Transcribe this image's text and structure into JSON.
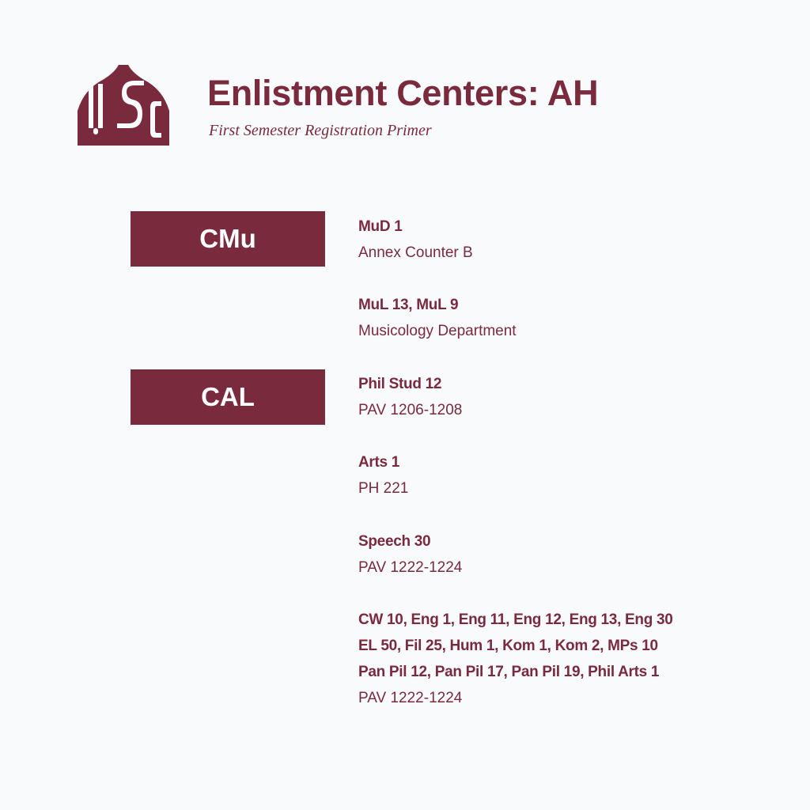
{
  "header": {
    "logo_text": "USC",
    "title": "Enlistment Centers: AH",
    "subtitle": "First Semester Registration Primer"
  },
  "colors": {
    "accent": "#7a2a3d",
    "background": "#f9fafc"
  },
  "groups": [
    {
      "label": "CMu",
      "entries": [
        {
          "courses": [
            "MuD 1"
          ],
          "location": "Annex Counter B"
        },
        {
          "courses": [
            "MuL 13, MuL 9"
          ],
          "location": "Musicology Department"
        }
      ]
    },
    {
      "label": "CAL",
      "entries": [
        {
          "courses": [
            "Phil Stud 12"
          ],
          "location": "PAV 1206-1208"
        },
        {
          "courses": [
            "Arts 1"
          ],
          "location": "PH 221"
        },
        {
          "courses": [
            "Speech 30"
          ],
          "location": "PAV 1222-1224"
        },
        {
          "courses": [
            "CW 10, Eng 1, Eng 11, Eng 12, Eng 13, Eng 30",
            "EL 50, Fil 25, Hum 1, Kom 1, Kom 2, MPs 10",
            "Pan Pil 12, Pan Pil 17, Pan Pil 19, Phil Arts 1"
          ],
          "location": "PAV 1222-1224"
        }
      ]
    }
  ]
}
